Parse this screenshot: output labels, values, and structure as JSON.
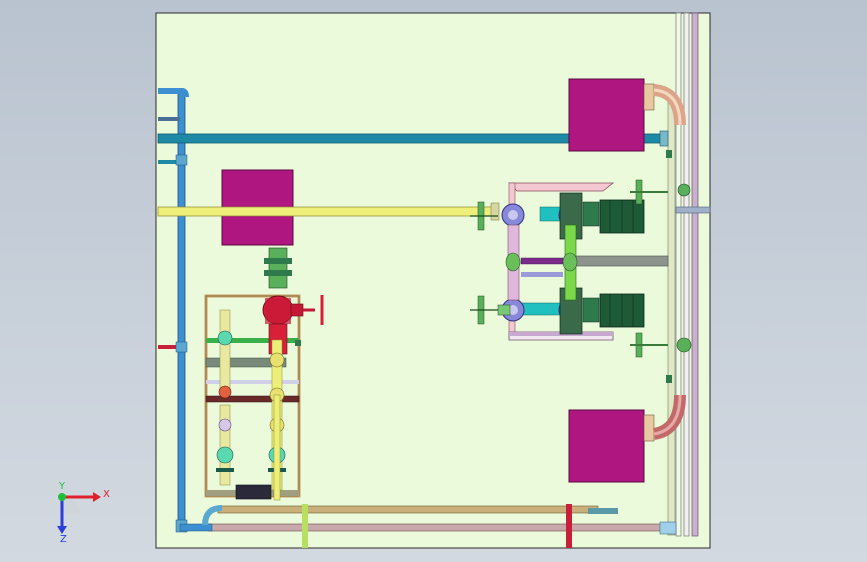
{
  "viewport": {
    "background": [
      "#b9c3cf",
      "#d3d9e0"
    ],
    "sheet_color": "#eafadb"
  },
  "axis_triad": {
    "x_label": "X",
    "y_label": "Y",
    "z_label": "Z",
    "x_color": "#e0202a",
    "y_color": "#1fbf3a",
    "z_color": "#2a3fd8"
  },
  "colors": {
    "magenta_block": "#b01680",
    "blue_pipe": "#1f7fc0",
    "teal_pipe": "#1e8aa6",
    "yellow_pipe": "#e8ea6a",
    "pipe_pink": "#d4a8c8",
    "pipe_green": "#5ec85a",
    "pump_dark": "#1f5a36",
    "valve_red": "#d8203a",
    "tan_pipe": "#c9b07a",
    "gray_pipe": "#8c948c"
  }
}
